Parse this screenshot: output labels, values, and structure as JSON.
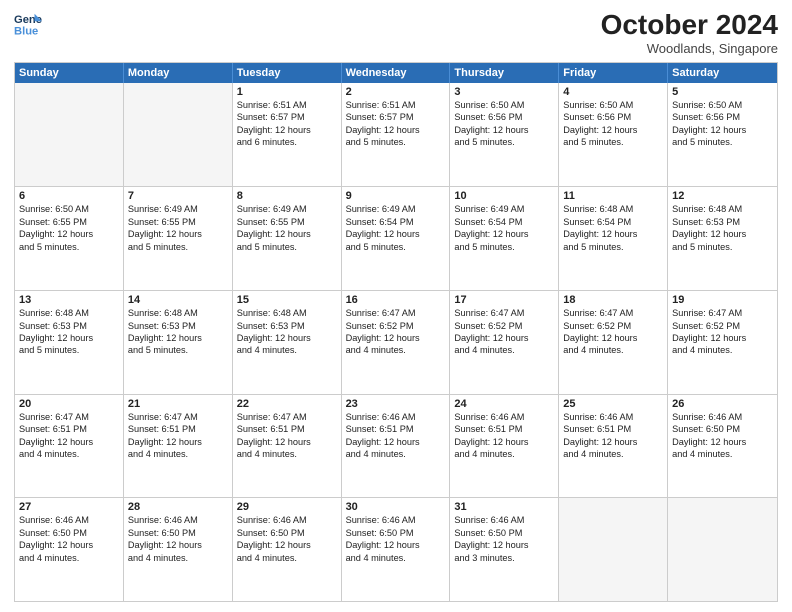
{
  "header": {
    "logo_line1": "General",
    "logo_line2": "Blue",
    "month": "October 2024",
    "location": "Woodlands, Singapore"
  },
  "days_of_week": [
    "Sunday",
    "Monday",
    "Tuesday",
    "Wednesday",
    "Thursday",
    "Friday",
    "Saturday"
  ],
  "weeks": [
    [
      {
        "day": "",
        "lines": [],
        "empty": true
      },
      {
        "day": "",
        "lines": [],
        "empty": true
      },
      {
        "day": "1",
        "lines": [
          "Sunrise: 6:51 AM",
          "Sunset: 6:57 PM",
          "Daylight: 12 hours",
          "and 6 minutes."
        ],
        "empty": false
      },
      {
        "day": "2",
        "lines": [
          "Sunrise: 6:51 AM",
          "Sunset: 6:57 PM",
          "Daylight: 12 hours",
          "and 5 minutes."
        ],
        "empty": false
      },
      {
        "day": "3",
        "lines": [
          "Sunrise: 6:50 AM",
          "Sunset: 6:56 PM",
          "Daylight: 12 hours",
          "and 5 minutes."
        ],
        "empty": false
      },
      {
        "day": "4",
        "lines": [
          "Sunrise: 6:50 AM",
          "Sunset: 6:56 PM",
          "Daylight: 12 hours",
          "and 5 minutes."
        ],
        "empty": false
      },
      {
        "day": "5",
        "lines": [
          "Sunrise: 6:50 AM",
          "Sunset: 6:56 PM",
          "Daylight: 12 hours",
          "and 5 minutes."
        ],
        "empty": false
      }
    ],
    [
      {
        "day": "6",
        "lines": [
          "Sunrise: 6:50 AM",
          "Sunset: 6:55 PM",
          "Daylight: 12 hours",
          "and 5 minutes."
        ],
        "empty": false
      },
      {
        "day": "7",
        "lines": [
          "Sunrise: 6:49 AM",
          "Sunset: 6:55 PM",
          "Daylight: 12 hours",
          "and 5 minutes."
        ],
        "empty": false
      },
      {
        "day": "8",
        "lines": [
          "Sunrise: 6:49 AM",
          "Sunset: 6:55 PM",
          "Daylight: 12 hours",
          "and 5 minutes."
        ],
        "empty": false
      },
      {
        "day": "9",
        "lines": [
          "Sunrise: 6:49 AM",
          "Sunset: 6:54 PM",
          "Daylight: 12 hours",
          "and 5 minutes."
        ],
        "empty": false
      },
      {
        "day": "10",
        "lines": [
          "Sunrise: 6:49 AM",
          "Sunset: 6:54 PM",
          "Daylight: 12 hours",
          "and 5 minutes."
        ],
        "empty": false
      },
      {
        "day": "11",
        "lines": [
          "Sunrise: 6:48 AM",
          "Sunset: 6:54 PM",
          "Daylight: 12 hours",
          "and 5 minutes."
        ],
        "empty": false
      },
      {
        "day": "12",
        "lines": [
          "Sunrise: 6:48 AM",
          "Sunset: 6:53 PM",
          "Daylight: 12 hours",
          "and 5 minutes."
        ],
        "empty": false
      }
    ],
    [
      {
        "day": "13",
        "lines": [
          "Sunrise: 6:48 AM",
          "Sunset: 6:53 PM",
          "Daylight: 12 hours",
          "and 5 minutes."
        ],
        "empty": false
      },
      {
        "day": "14",
        "lines": [
          "Sunrise: 6:48 AM",
          "Sunset: 6:53 PM",
          "Daylight: 12 hours",
          "and 5 minutes."
        ],
        "empty": false
      },
      {
        "day": "15",
        "lines": [
          "Sunrise: 6:48 AM",
          "Sunset: 6:53 PM",
          "Daylight: 12 hours",
          "and 4 minutes."
        ],
        "empty": false
      },
      {
        "day": "16",
        "lines": [
          "Sunrise: 6:47 AM",
          "Sunset: 6:52 PM",
          "Daylight: 12 hours",
          "and 4 minutes."
        ],
        "empty": false
      },
      {
        "day": "17",
        "lines": [
          "Sunrise: 6:47 AM",
          "Sunset: 6:52 PM",
          "Daylight: 12 hours",
          "and 4 minutes."
        ],
        "empty": false
      },
      {
        "day": "18",
        "lines": [
          "Sunrise: 6:47 AM",
          "Sunset: 6:52 PM",
          "Daylight: 12 hours",
          "and 4 minutes."
        ],
        "empty": false
      },
      {
        "day": "19",
        "lines": [
          "Sunrise: 6:47 AM",
          "Sunset: 6:52 PM",
          "Daylight: 12 hours",
          "and 4 minutes."
        ],
        "empty": false
      }
    ],
    [
      {
        "day": "20",
        "lines": [
          "Sunrise: 6:47 AM",
          "Sunset: 6:51 PM",
          "Daylight: 12 hours",
          "and 4 minutes."
        ],
        "empty": false
      },
      {
        "day": "21",
        "lines": [
          "Sunrise: 6:47 AM",
          "Sunset: 6:51 PM",
          "Daylight: 12 hours",
          "and 4 minutes."
        ],
        "empty": false
      },
      {
        "day": "22",
        "lines": [
          "Sunrise: 6:47 AM",
          "Sunset: 6:51 PM",
          "Daylight: 12 hours",
          "and 4 minutes."
        ],
        "empty": false
      },
      {
        "day": "23",
        "lines": [
          "Sunrise: 6:46 AM",
          "Sunset: 6:51 PM",
          "Daylight: 12 hours",
          "and 4 minutes."
        ],
        "empty": false
      },
      {
        "day": "24",
        "lines": [
          "Sunrise: 6:46 AM",
          "Sunset: 6:51 PM",
          "Daylight: 12 hours",
          "and 4 minutes."
        ],
        "empty": false
      },
      {
        "day": "25",
        "lines": [
          "Sunrise: 6:46 AM",
          "Sunset: 6:51 PM",
          "Daylight: 12 hours",
          "and 4 minutes."
        ],
        "empty": false
      },
      {
        "day": "26",
        "lines": [
          "Sunrise: 6:46 AM",
          "Sunset: 6:50 PM",
          "Daylight: 12 hours",
          "and 4 minutes."
        ],
        "empty": false
      }
    ],
    [
      {
        "day": "27",
        "lines": [
          "Sunrise: 6:46 AM",
          "Sunset: 6:50 PM",
          "Daylight: 12 hours",
          "and 4 minutes."
        ],
        "empty": false
      },
      {
        "day": "28",
        "lines": [
          "Sunrise: 6:46 AM",
          "Sunset: 6:50 PM",
          "Daylight: 12 hours",
          "and 4 minutes."
        ],
        "empty": false
      },
      {
        "day": "29",
        "lines": [
          "Sunrise: 6:46 AM",
          "Sunset: 6:50 PM",
          "Daylight: 12 hours",
          "and 4 minutes."
        ],
        "empty": false
      },
      {
        "day": "30",
        "lines": [
          "Sunrise: 6:46 AM",
          "Sunset: 6:50 PM",
          "Daylight: 12 hours",
          "and 4 minutes."
        ],
        "empty": false
      },
      {
        "day": "31",
        "lines": [
          "Sunrise: 6:46 AM",
          "Sunset: 6:50 PM",
          "Daylight: 12 hours",
          "and 3 minutes."
        ],
        "empty": false
      },
      {
        "day": "",
        "lines": [],
        "empty": true
      },
      {
        "day": "",
        "lines": [],
        "empty": true
      }
    ]
  ]
}
